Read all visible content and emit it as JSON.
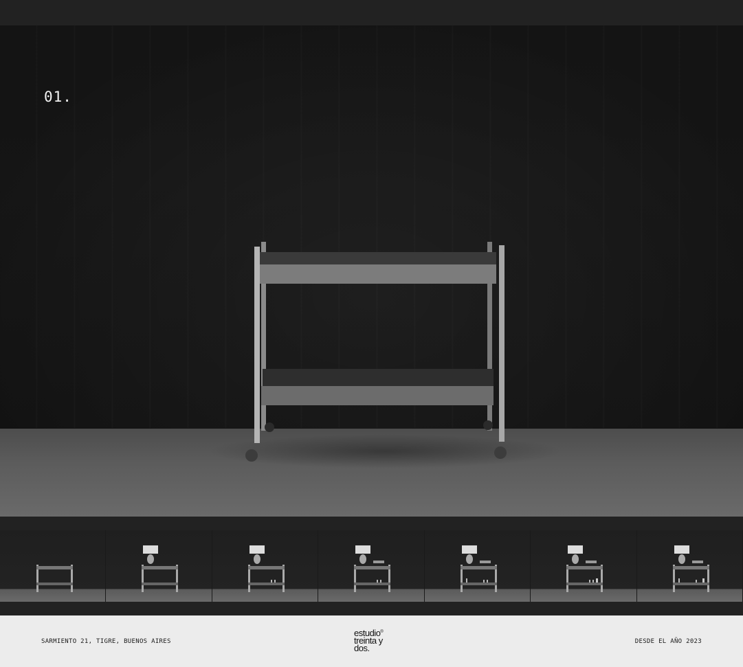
{
  "hero": {
    "slide_number": "01.",
    "image_description_icon": "bar-cart-photo"
  },
  "thumbnails": [
    {
      "icon": "bar-cart-empty"
    },
    {
      "icon": "bar-cart-with-lamp"
    },
    {
      "icon": "bar-cart-with-lamp"
    },
    {
      "icon": "bar-cart-with-lamp-glasses"
    },
    {
      "icon": "bar-cart-with-lamp-glasses"
    },
    {
      "icon": "bar-cart-with-lamp-glasses"
    },
    {
      "icon": "bar-cart-with-lamp-glasses"
    }
  ],
  "footer": {
    "address": "SARMIENTO 21, TIGRE, BUENOS AIRES",
    "since": "DESDE EL AÑO 2023",
    "logo": {
      "line1": "estudio",
      "registered": "®",
      "line2": "treinta y",
      "line3": "dos."
    }
  },
  "colors": {
    "background": "#222222",
    "footer_background": "#ececec",
    "text_light": "#f2f2f2",
    "text_dark": "#1a1a1a"
  }
}
